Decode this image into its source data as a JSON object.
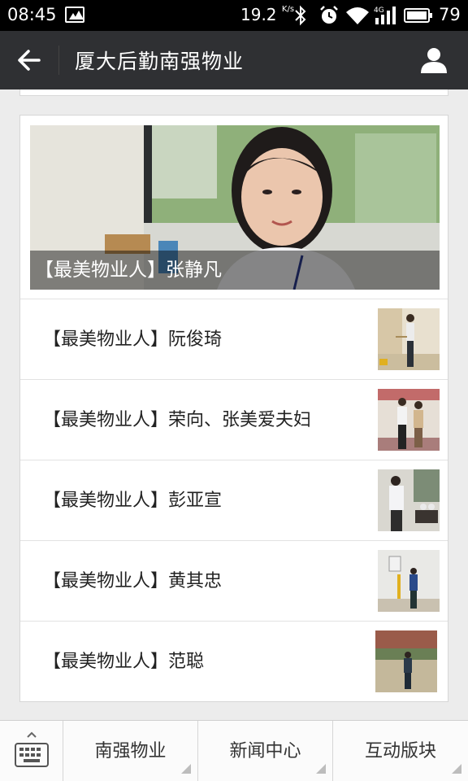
{
  "status_bar": {
    "time": "08:45",
    "net_speed": "19.2",
    "net_speed_unit": "K/s",
    "network_type": "4G",
    "battery_level": "79",
    "icons": [
      "image-icon",
      "bluetooth-icon",
      "alarm-icon",
      "wifi-icon",
      "signal-icon",
      "battery-icon"
    ]
  },
  "header": {
    "title": "厦大后勤南强物业",
    "back_icon": "back-arrow-icon",
    "profile_icon": "person-icon"
  },
  "cover_article": {
    "caption": "【最美物业人】张静凡"
  },
  "articles": [
    {
      "title": "【最美物业人】阮俊琦"
    },
    {
      "title": "【最美物业人】荣向、张美爱夫妇"
    },
    {
      "title": "【最美物业人】彭亚宣"
    },
    {
      "title": "【最美物业人】黄其忠"
    },
    {
      "title": "【最美物业人】范聪"
    }
  ],
  "bottom_menu": {
    "keyboard_icon": "keyboard-icon",
    "items": [
      {
        "label": "南强物业"
      },
      {
        "label": "新闻中心"
      },
      {
        "label": "互动版块"
      }
    ]
  },
  "colors": {
    "header_bg": "#2f3033",
    "status_bg": "#000000",
    "page_bg": "#ececec",
    "card_bg": "#ffffff"
  }
}
